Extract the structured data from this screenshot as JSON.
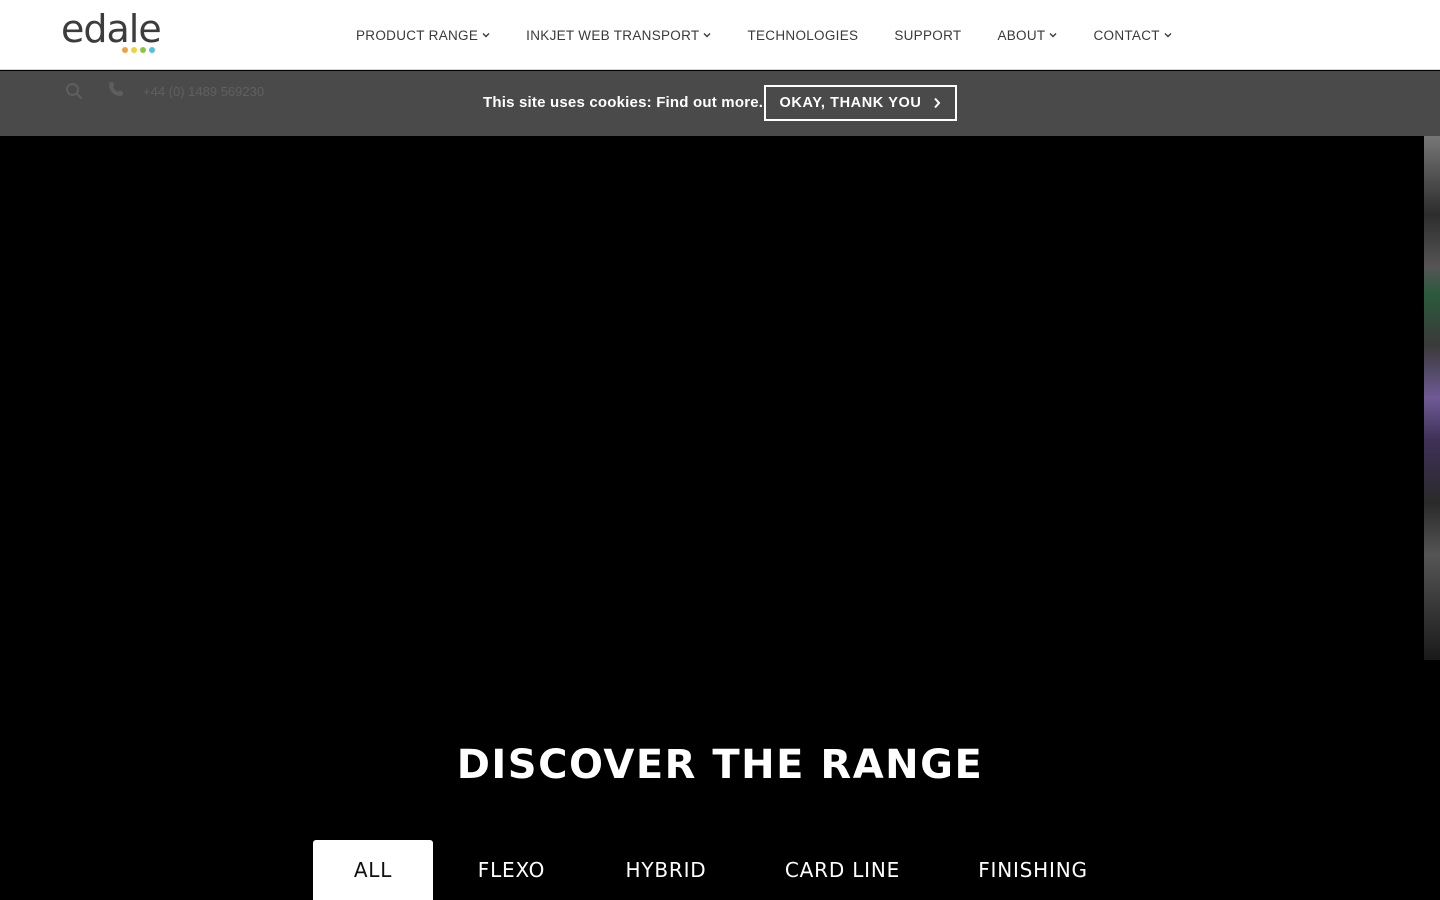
{
  "header": {
    "logo_text": "edale",
    "logo_dots": [
      "#f0a23a",
      "#f2d23b",
      "#8cc63f",
      "#4fc3e6"
    ],
    "nav": [
      {
        "label": "PRODUCT RANGE",
        "has_dropdown": true
      },
      {
        "label": "INKJET WEB TRANSPORT",
        "has_dropdown": true
      },
      {
        "label": "TECHNOLOGIES",
        "has_dropdown": false
      },
      {
        "label": "SUPPORT",
        "has_dropdown": false
      },
      {
        "label": "ABOUT",
        "has_dropdown": true
      },
      {
        "label": "CONTACT",
        "has_dropdown": true
      }
    ]
  },
  "utility": {
    "phone": "+44 (0) 1489 569230",
    "cookie_message": "This site uses cookies: Find out more.",
    "cookie_button": "OKAY, THANK YOU"
  },
  "main": {
    "heading": "DISCOVER THE RANGE",
    "tabs": [
      {
        "label": "ALL",
        "active": true
      },
      {
        "label": "FLEXO",
        "active": false
      },
      {
        "label": "HYBRID",
        "active": false
      },
      {
        "label": "CARD LINE",
        "active": false
      },
      {
        "label": "FINISHING",
        "active": false
      }
    ]
  },
  "colors": {
    "header_bg": "#ffffff",
    "utility_bg": "#4a4a4a",
    "hero_bg": "#000000",
    "text_dark": "#3a3a3a"
  }
}
